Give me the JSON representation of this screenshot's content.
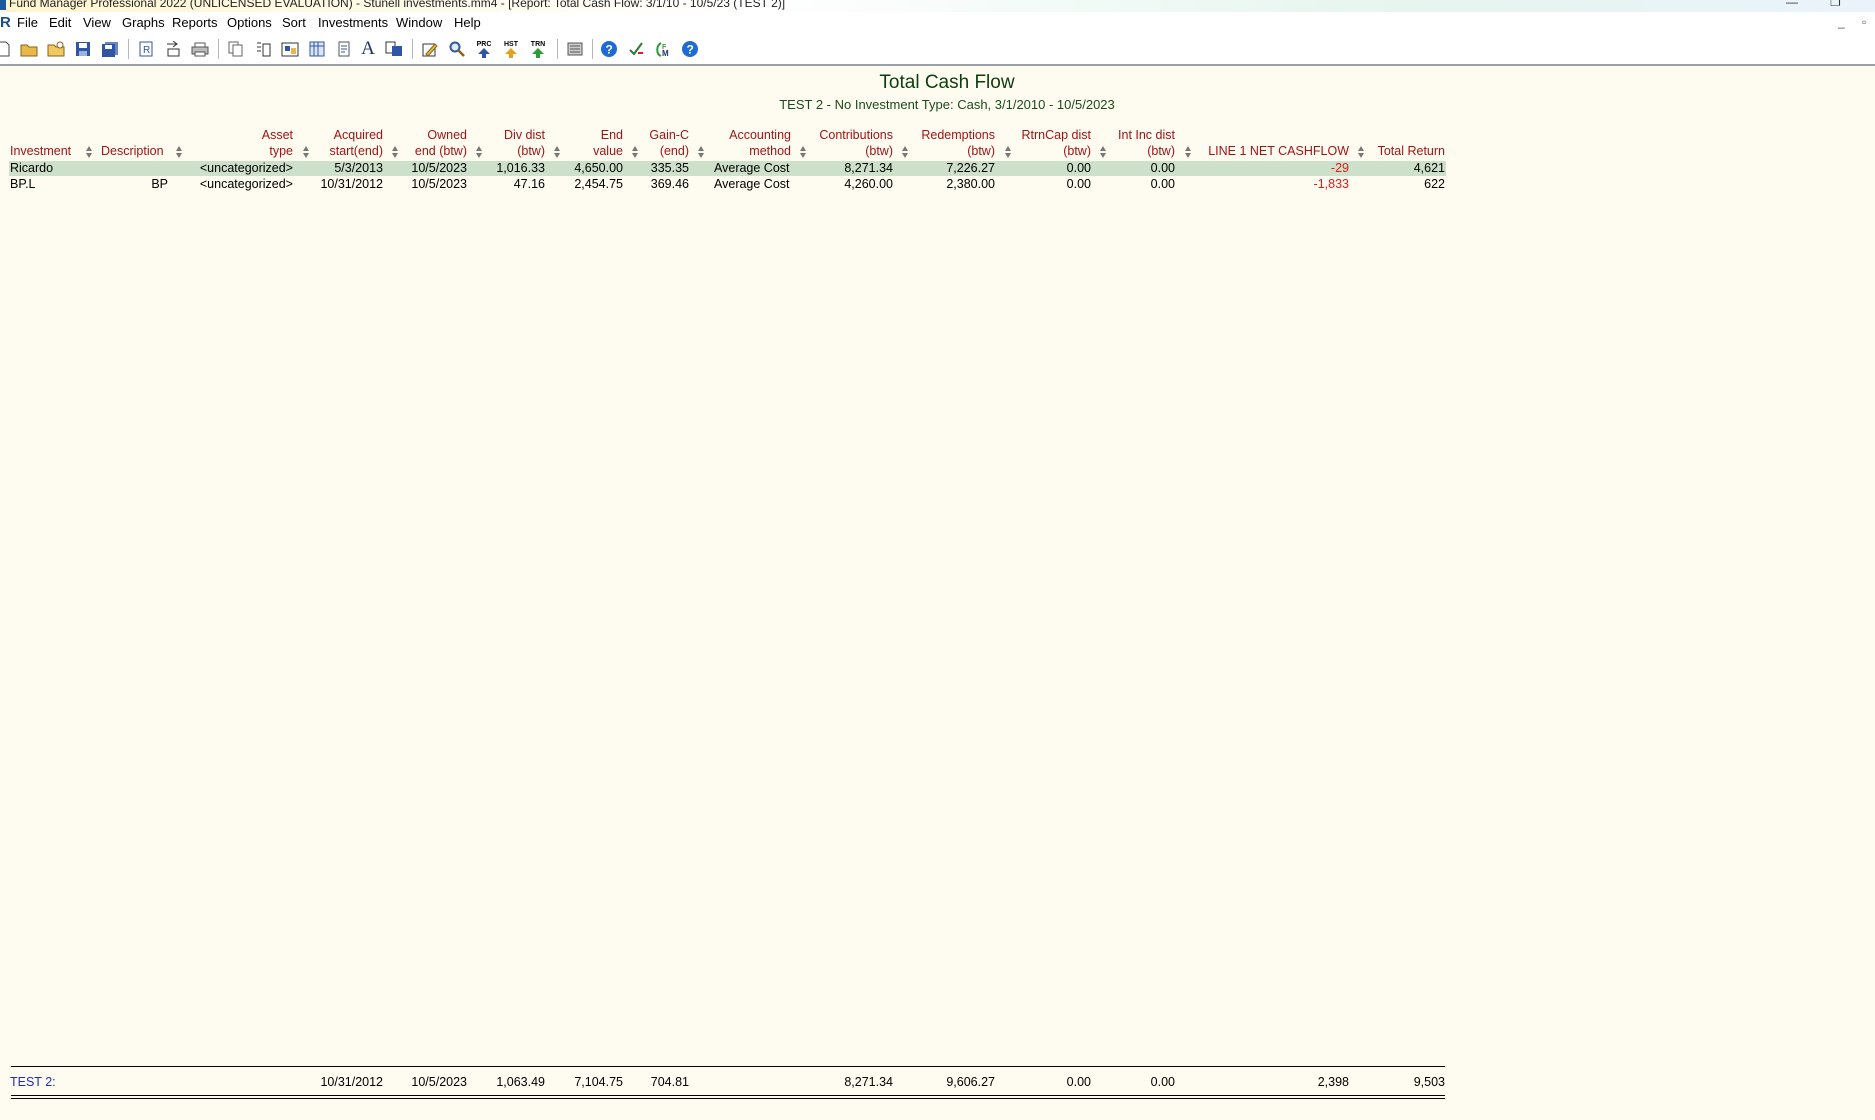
{
  "window": {
    "title": "Fund Manager Professional 2022 (UNLICENSED EVALUATION) - Stunell investments.mm4 - [Report: Total Cash Flow: 3/1/10 - 10/5/23 (TEST 2)]",
    "minimize": "—",
    "restore": "❐"
  },
  "menu": [
    "File",
    "Edit",
    "View",
    "Graphs",
    "Reports",
    "Options",
    "Sort",
    "Investments",
    "Window",
    "Help"
  ],
  "mdi_controls": {
    "minimize": "_",
    "restore": "▫"
  },
  "toolbar": {
    "prc_label": "PRC",
    "hst_label": "HST",
    "trn_label": "TRN",
    "font_label": "A",
    "fm_label": "FM"
  },
  "report": {
    "title": "Total Cash Flow",
    "subtitle": "TEST 2 - No Investment Type: Cash, 3/1/2010 - 10/5/2023",
    "columns": [
      {
        "top": "",
        "bottom": "Investment"
      },
      {
        "top": "",
        "bottom": "Description"
      },
      {
        "top": "Asset",
        "bottom": "type"
      },
      {
        "top": "Acquired",
        "bottom": "start(end)"
      },
      {
        "top": "Owned",
        "bottom": "end (btw)"
      },
      {
        "top": "Div dist",
        "bottom": "(btw)"
      },
      {
        "top": "End",
        "bottom": "value"
      },
      {
        "top": "Gain-C",
        "bottom": "(end)"
      },
      {
        "top": "Accounting",
        "bottom": "method"
      },
      {
        "top": "Contributions",
        "bottom": "(btw)"
      },
      {
        "top": "Redemptions",
        "bottom": "(btw)"
      },
      {
        "top": "RtrnCap dist",
        "bottom": "(btw)"
      },
      {
        "top": "Int Inc dist",
        "bottom": "(btw)"
      },
      {
        "top": "",
        "bottom": "LINE 1 NET CASHFLOW"
      },
      {
        "top": "",
        "bottom": "Total Return"
      }
    ],
    "rows": [
      [
        "Ricardo",
        "",
        "<uncategorized>",
        "5/3/2013",
        "10/5/2023",
        "1,016.33",
        "4,650.00",
        "335.35",
        "Average Cost",
        "8,271.34",
        "7,226.27",
        "0.00",
        "0.00",
        "-29",
        "4,621"
      ],
      [
        "BP.L",
        "BP",
        "<uncategorized>",
        "10/31/2012",
        "10/5/2023",
        "47.16",
        "2,454.75",
        "369.46",
        "Average Cost",
        "4,260.00",
        "2,380.00",
        "0.00",
        "0.00",
        "-1,833",
        "622"
      ]
    ],
    "total": {
      "label": "TEST 2:",
      "acquired": "10/31/2012",
      "owned": "10/5/2023",
      "div_dist": "1,063.49",
      "end_value": "7,104.75",
      "gain_c": "704.81",
      "contributions": "8,271.34",
      "redemptions": "9,606.27",
      "rtrncap": "0.00",
      "int_inc": "0.00",
      "net_cashflow": "2,398",
      "total_return": "9,503"
    }
  },
  "colors": {
    "header_text": "#a11414",
    "negative": "#e01b1b",
    "selected_row": "#cde0c9",
    "total_label": "#1a2fb0",
    "background": "#fefcf1"
  }
}
